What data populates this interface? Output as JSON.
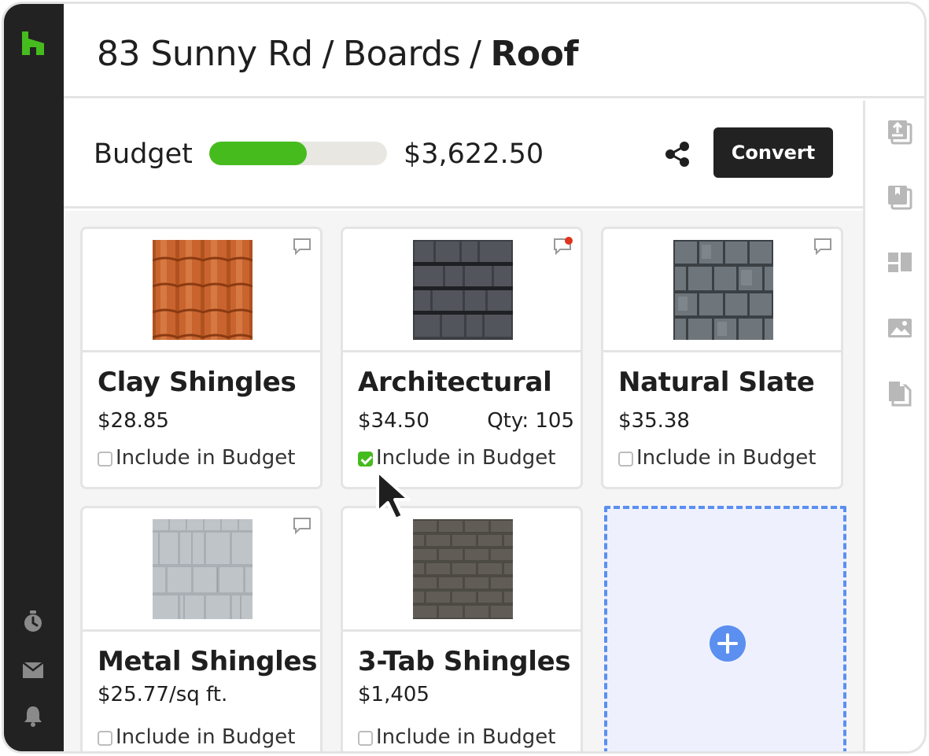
{
  "breadcrumb": {
    "items": [
      "83 Sunny Rd",
      "Boards"
    ],
    "separator": "/",
    "current": "Roof"
  },
  "budget": {
    "label": "Budget",
    "amount": "$3,622.50",
    "progress": 0.55
  },
  "toolbar": {
    "convert_label": "Convert"
  },
  "cards": [
    {
      "title": "Clay Shingles",
      "price": "$28.85",
      "qty": "",
      "include_label": "Include in Budget",
      "included": false,
      "has_new_comment": false,
      "material": "clay"
    },
    {
      "title": "Architectural",
      "price": "$34.50",
      "qty": "Qty: 105",
      "include_label": "Include in Budget",
      "included": true,
      "has_new_comment": true,
      "material": "architectural"
    },
    {
      "title": "Natural Slate",
      "price": "$35.38",
      "qty": "",
      "include_label": "Include in Budget",
      "included": false,
      "has_new_comment": false,
      "material": "slate"
    },
    {
      "title": "Metal Shingles",
      "price": "$25.77/sq ft.",
      "qty": "",
      "include_label": "Include in Budget",
      "included": false,
      "has_new_comment": false,
      "material": "metal"
    },
    {
      "title": "3-Tab Shingles",
      "price": "$1,405",
      "qty": "",
      "include_label": "Include in Budget",
      "included": false,
      "has_new_comment": false,
      "material": "three-tab"
    }
  ],
  "colors": {
    "accent_green": "#46bb1e",
    "dark": "#222222",
    "add_blue": "#5b8ff0",
    "notification_red": "#e0321c"
  },
  "icons": {
    "left_rail": [
      "houzz-logo-icon",
      "timer-icon",
      "inbox-icon",
      "bell-icon"
    ],
    "right_rail": [
      "upload-icon",
      "book-icon",
      "layout-icon",
      "image-icon",
      "document-icon"
    ],
    "share": "share-icon",
    "comment": "comment-icon",
    "add": "plus-circle-icon"
  }
}
